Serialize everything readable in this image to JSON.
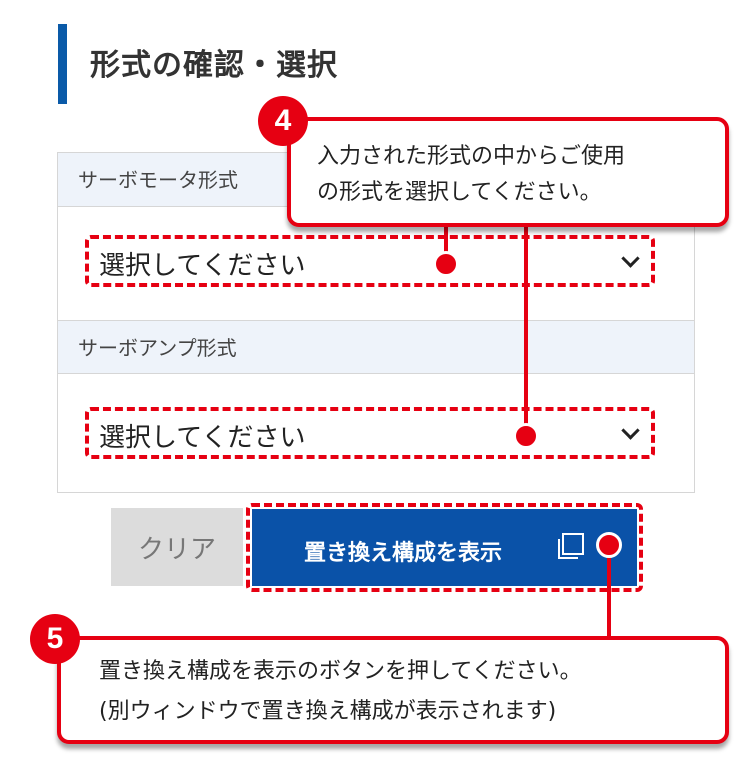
{
  "heading": {
    "title": "形式の確認・選択"
  },
  "form": {
    "servomotor": {
      "label": "サーボモータ形式",
      "value": "選択してください"
    },
    "servoamp": {
      "label": "サーボアンプ形式",
      "value": "選択してください"
    }
  },
  "buttons": {
    "clear_label": "クリア",
    "show_label": "置き換え構成を表示"
  },
  "callouts": {
    "step4": {
      "number": "4",
      "line1": "入力された形式の中からご使用",
      "line2": "の形式を選択してください。"
    },
    "step5": {
      "number": "5",
      "line1": "置き換え構成を表示のボタンを押してください。",
      "line2": "(別ウィンドウで置き換え構成が表示されます)"
    }
  },
  "icons": {
    "external_window": "external-window-icon",
    "dropdown": "chevron-down-icon"
  },
  "colors": {
    "accent_blue": "#0a52a8",
    "highlight_red": "#e60012",
    "label_background": "#eef3fa",
    "clear_button": "#dcdcdc"
  }
}
